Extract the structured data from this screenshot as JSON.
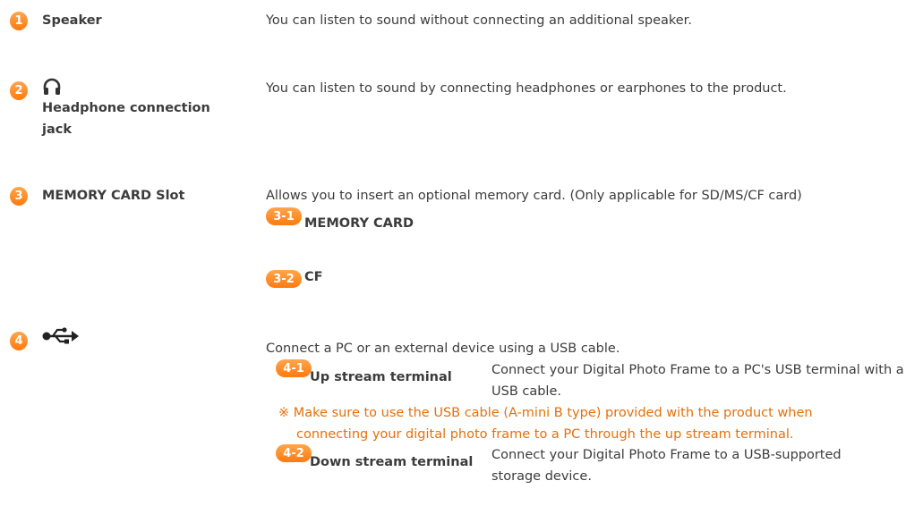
{
  "items": [
    {
      "number": "1",
      "label": "Speaker",
      "description": "You can listen to sound without connecting an additional speaker."
    },
    {
      "number": "2",
      "icon": "headphone-icon",
      "label": "Headphone connection jack",
      "description": "You can listen to sound by connecting headphones or earphones to the product."
    },
    {
      "number": "3",
      "label": "MEMORY CARD Slot",
      "description": "Allows you to insert an optional memory card. (Only applicable for SD/MS/CF card)",
      "sub_items": [
        {
          "badge": "3-1",
          "label": "MEMORY CARD"
        },
        {
          "badge": "3-2",
          "label": "CF"
        }
      ]
    },
    {
      "number": "4",
      "icon": "usb-icon",
      "description": "Connect a PC or an external device using a USB cable.",
      "sub_items": [
        {
          "badge": "4-1",
          "label": "Up stream terminal",
          "description": "Connect your Digital Photo Frame to a PC's USB terminal with a USB cable."
        },
        {
          "badge": "4-2",
          "label": "Down stream terminal",
          "description": "Connect your Digital Photo Frame to a USB-supported storage device."
        }
      ],
      "note": "※ Make sure to use the USB cable (A-mini B type) provided with the product when connecting your digital photo frame to a PC through the up stream terminal."
    }
  ],
  "colors": {
    "accent": "#ff8a1f",
    "note": "#e5700a",
    "text": "#3c3c3c"
  }
}
